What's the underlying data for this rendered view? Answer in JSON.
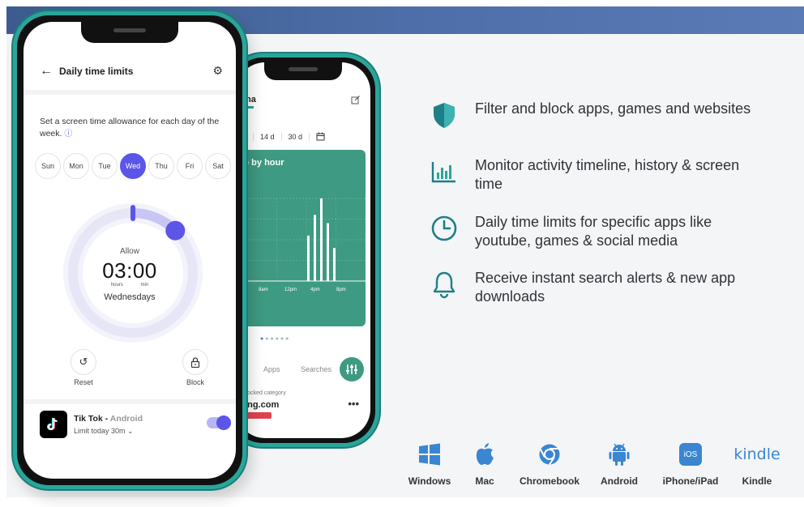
{
  "colors": {
    "teal": "#2aa59b",
    "purple": "#5b55e8",
    "blue": "#3a86d1",
    "banner": "#4d6ea8"
  },
  "front_phone": {
    "title": "Daily time limits",
    "back_icon": "arrow-left-icon",
    "settings_icon": "gear-icon",
    "description": "Set a screen time allowance for each day of the week.",
    "days": [
      {
        "label": "Sun",
        "active": false
      },
      {
        "label": "Mon",
        "active": false
      },
      {
        "label": "Tue",
        "active": false
      },
      {
        "label": "Wed",
        "active": true
      },
      {
        "label": "Thu",
        "active": false
      },
      {
        "label": "Fri",
        "active": false
      },
      {
        "label": "Sat",
        "active": false
      }
    ],
    "dial": {
      "allow_label": "Allow",
      "time": "03:00",
      "hours_label": "hours",
      "min_label": "min",
      "day_label": "Wednesdays",
      "fraction": 0.125
    },
    "reset_label": "Reset",
    "block_label": "Block",
    "app": {
      "name": "Tik Tok",
      "separator": " - ",
      "platform": "Android",
      "limit": "Limit today 30m",
      "enabled": true
    }
  },
  "back_phone": {
    "name_fragment": "na",
    "tabs": [
      "d",
      "14 d",
      "30 d"
    ],
    "calendar_icon": "calendar-icon",
    "card_title": "e by hour",
    "time_labels": [
      "8am",
      "12pm",
      "4pm",
      "8pm"
    ],
    "bars": [
      0.55,
      0.8,
      1.0,
      0.7,
      0.4
    ],
    "nav": {
      "apps": "Apps",
      "searches": "Searches"
    },
    "blocked_label": "Blocked category",
    "domain": "ling.com",
    "more": "•••"
  },
  "features": [
    {
      "icon": "shield-icon",
      "text": "Filter and block apps, games and websites"
    },
    {
      "icon": "bar-chart-icon",
      "text": "Monitor activity timeline, history & screen time"
    },
    {
      "icon": "clock-icon",
      "text": "Daily time limits for specific apps like youtube, games & social media"
    },
    {
      "icon": "bell-icon",
      "text": "Receive instant search alerts & new app downloads"
    }
  ],
  "platforms": [
    {
      "icon": "windows-icon",
      "label": "Windows"
    },
    {
      "icon": "apple-icon",
      "label": "Mac"
    },
    {
      "icon": "chrome-icon",
      "label": "Chromebook"
    },
    {
      "icon": "android-icon",
      "label": "Android"
    },
    {
      "icon": "ios-icon",
      "label": "iPhone/iPad",
      "icon_text": "iOS"
    },
    {
      "icon": "kindle-icon",
      "label": "Kindle",
      "icon_text": "kindle"
    }
  ]
}
